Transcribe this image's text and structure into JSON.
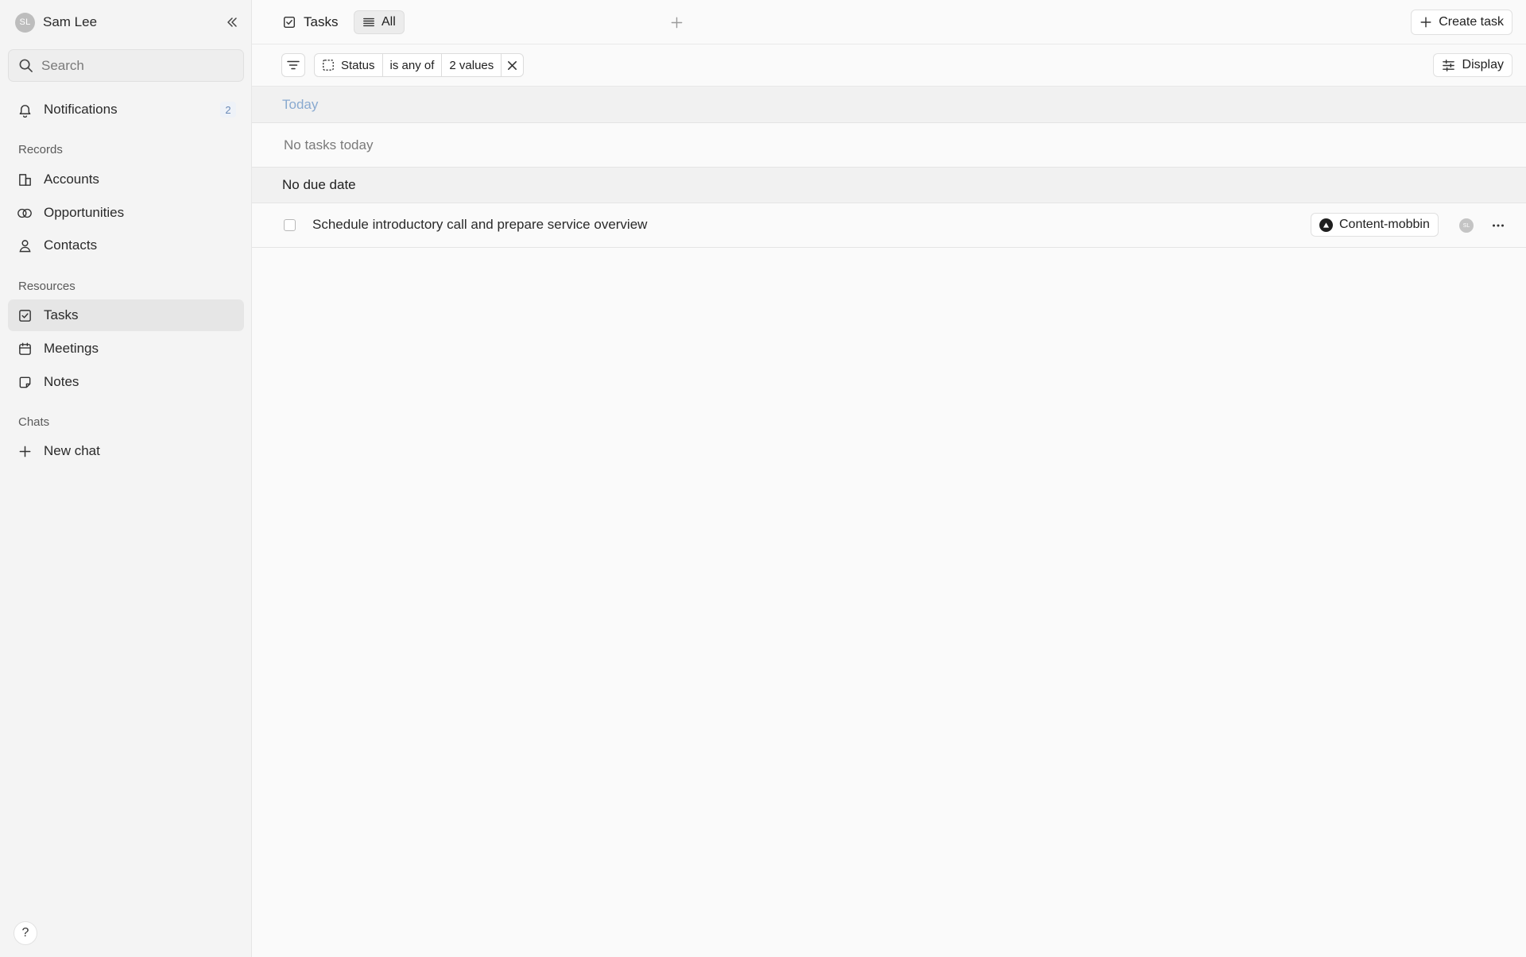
{
  "sidebar": {
    "user": {
      "initials": "SL",
      "name": "Sam Lee"
    },
    "search": {
      "placeholder": "Search"
    },
    "notifications": {
      "label": "Notifications",
      "count": "2"
    },
    "sections": {
      "records": "Records",
      "resources": "Resources",
      "chats": "Chats"
    },
    "records_items": [
      {
        "label": "Accounts",
        "icon": "building-icon"
      },
      {
        "label": "Opportunities",
        "icon": "overlapping-circles-icon"
      },
      {
        "label": "Contacts",
        "icon": "person-icon"
      }
    ],
    "resources_items": [
      {
        "label": "Tasks",
        "icon": "checkbox-icon",
        "active": true
      },
      {
        "label": "Meetings",
        "icon": "calendar-icon"
      },
      {
        "label": "Notes",
        "icon": "note-icon"
      }
    ],
    "chats_items": [
      {
        "label": "New chat",
        "icon": "plus-icon"
      }
    ],
    "help_label": "?"
  },
  "header": {
    "tab_tasks": "Tasks",
    "tab_all": "All",
    "create_task": "Create task"
  },
  "filter": {
    "field": "Status",
    "operator": "is any of",
    "value": "2 values",
    "display": "Display"
  },
  "groups": {
    "today": {
      "label": "Today",
      "empty": "No tasks today"
    },
    "no_due_date": {
      "label": "No due date",
      "tasks": [
        {
          "title": "Schedule introductory call and prepare service overview",
          "tag": "Content-mobbin",
          "assignee_initials": "SL"
        }
      ]
    }
  },
  "colors": {
    "sidebar_bg": "#f4f4f4",
    "main_bg": "#fafafa",
    "active_item_bg": "#e6e6e6",
    "today_label": "#8aaad0",
    "badge_text": "#6a8ab8"
  }
}
